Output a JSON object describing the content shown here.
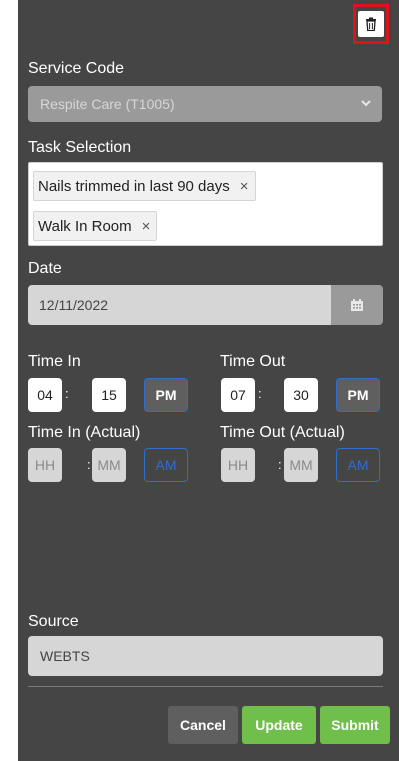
{
  "header": {
    "delete_icon": "trash-icon"
  },
  "service": {
    "label": "Service Code",
    "value": "Respite Care (T1005)"
  },
  "tasks": {
    "label": "Task Selection",
    "items": [
      {
        "label": "Nails trimmed in last 90 days",
        "remove": "×"
      },
      {
        "label": "Walk In Room",
        "remove": "×"
      }
    ]
  },
  "date": {
    "label": "Date",
    "value": "12/11/2022",
    "icon": "calendar-icon"
  },
  "time_in": {
    "label": "Time In",
    "hour": "04",
    "minute": "15",
    "period": "PM"
  },
  "time_out": {
    "label": "Time Out",
    "hour": "07",
    "minute": "30",
    "period": "PM"
  },
  "time_in_actual": {
    "label": "Time In (Actual)",
    "hour_placeholder": "HH",
    "minute_placeholder": "MM",
    "period": "AM"
  },
  "time_out_actual": {
    "label": "Time Out (Actual)",
    "hour_placeholder": "HH",
    "minute_placeholder": "MM",
    "period": "AM"
  },
  "separator": ":",
  "source": {
    "label": "Source",
    "value": "WEBTS"
  },
  "buttons": {
    "cancel": "Cancel",
    "update": "Update",
    "submit": "Submit"
  },
  "colors": {
    "panel": "#454545",
    "accent_green": "#6fbf4a",
    "highlight_red": "#e0121b",
    "blue": "#2e6fcc"
  }
}
